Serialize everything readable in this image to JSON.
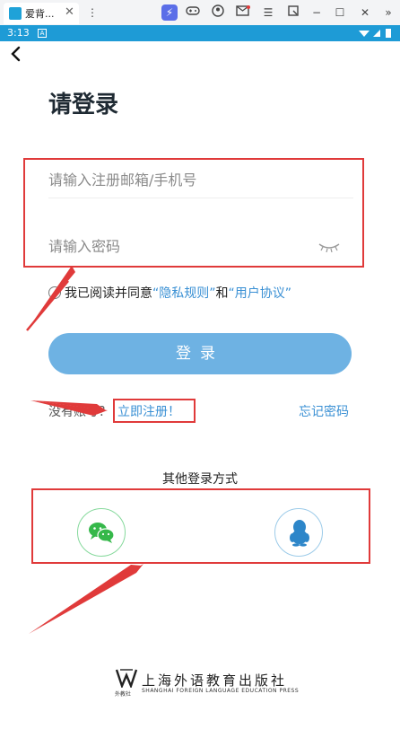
{
  "window": {
    "tab_title": "爱背...",
    "tab_close": "✕",
    "buttons": [
      "lightning-icon",
      "gamepad-icon",
      "account-icon",
      "mail-icon",
      "menu-icon",
      "window-icon",
      "minimize-icon",
      "maximize-icon",
      "close-icon",
      "expand-icon"
    ]
  },
  "status": {
    "time": "3:13",
    "notif_icon": "A"
  },
  "page": {
    "title": "请登录",
    "account_placeholder": "请输入注册邮箱/手机号",
    "password_placeholder": "请输入密码",
    "agree_prefix": "我已阅读并同意",
    "privacy": "“隐私规则”",
    "agree_and": "和",
    "terms": "“用户协议”",
    "login_label": "登录",
    "no_account": "没有账号？",
    "register": "立即注册！",
    "forgot": "忘记密码",
    "other_login": "其他登录方式",
    "publisher_cn": "上海外语教育出版社",
    "publisher_en": "SHANGHAI FOREIGN LANGUAGE EDUCATION PRESS",
    "publisher_short": "外教社"
  },
  "colors": {
    "accent": "#1e9bd6",
    "link": "#3a90d4",
    "button": "#6eb2e3",
    "annotation_red": "#e03a3a",
    "wechat_green": "#35b84a",
    "qq_blue": "#2d86c9"
  }
}
